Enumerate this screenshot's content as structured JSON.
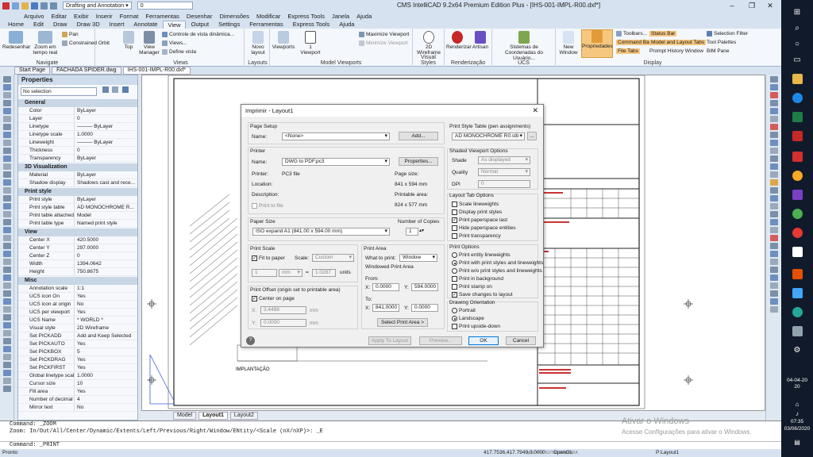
{
  "titlebar": {
    "title": "CMS IntelliCAD 9.2x64 Premium Edition Plus - [IHS-001-IMPL-R00.dxf*]",
    "workspace": "Drafting and Annotation",
    "layer_value": "0",
    "minimize": "–",
    "maximize": "❐",
    "close": "✕"
  },
  "menu": [
    "Arquivo",
    "Editar",
    "Exibir",
    "Inserir",
    "Format",
    "Ferramentas",
    "Desenhar",
    "Dimensões",
    "Modificar",
    "Express Tools",
    "Janela",
    "Ajuda"
  ],
  "ribbon_tabs": [
    "Home",
    "Edit",
    "Draw",
    "Draw 3D",
    "Insert",
    "Annotate",
    "View",
    "Output",
    "Settings",
    "Ferramentas",
    "Express Tools",
    "Ajuda"
  ],
  "ribbon": {
    "navigate": {
      "label": "Navigate",
      "redesenhar": "Redesenhar",
      "zoom": "Zoom em tempo real",
      "pan": "Pan",
      "orbit": "Constrained Orbit"
    },
    "views": {
      "label": "Views",
      "top": "Top",
      "view_manager": "View Manager",
      "controle": "Controle de vista dinâmica...",
      "views": "Views...",
      "define": "Define vista"
    },
    "layouts": {
      "label": "Layouts",
      "novo": "Novo layout"
    },
    "model_viewports": {
      "label": "Model Viewports",
      "viewports": "Viewports",
      "one": "1 Viewport",
      "max": "Maximize Viewport",
      "min": "Minimize Viewport"
    },
    "visual_styles": {
      "label": "Visual Styles",
      "wire": "2D Wireframe"
    },
    "render": {
      "label": "Renderização",
      "renderizar": "Renderizar",
      "artisan": "Artisan"
    },
    "ucs": {
      "label": "UCS",
      "sistemas": "Sistemas de Coordenadas do Usuário..."
    },
    "display": {
      "label": "Display",
      "new_window": "New Window",
      "propriedades": "Propriedades",
      "toolbars": "Toolbars...",
      "command_bar": "Command Bar",
      "file_tabs": "File Tabs",
      "status_bar": "Status Bar",
      "model_layout": "Model and Layout Tabs",
      "prompt_history": "Prompt History Window",
      "selection_filter": "Selection Filter",
      "tool_palettes": "Tool Palettes",
      "bim_pane": "BIM Pane"
    }
  },
  "doc_tabs": [
    "Start Page",
    "FACHADA SPIDER.dwg",
    "IHS-001-IMPL-R00.dxf*"
  ],
  "properties": {
    "title": "Properties",
    "selection": "No selection",
    "sections": [
      {
        "name": "General",
        "rows": [
          [
            "Color",
            "ByLayer"
          ],
          [
            "Layer",
            "0"
          ],
          [
            "Linetype",
            "——— ByLayer"
          ],
          [
            "Linetype scale",
            "1.0000"
          ],
          [
            "Lineweight",
            "——— ByLayer"
          ],
          [
            "Thickness",
            "0"
          ],
          [
            "Transparency",
            "ByLayer"
          ]
        ]
      },
      {
        "name": "3D Visualization",
        "rows": [
          [
            "Material",
            "ByLayer"
          ],
          [
            "Shadow display",
            "Shadows cast and rece..."
          ]
        ]
      },
      {
        "name": "Print style",
        "rows": [
          [
            "Print style",
            "ByLayer"
          ],
          [
            "Print style table",
            "AD MONOCHROME R..."
          ],
          [
            "Print table attached to",
            "Model"
          ],
          [
            "Print table type",
            "Named print style"
          ]
        ]
      },
      {
        "name": "View",
        "rows": [
          [
            "Center X",
            "420.5000"
          ],
          [
            "Center Y",
            "297.0000"
          ],
          [
            "Center Z",
            "0"
          ],
          [
            "Width",
            "1394.0642"
          ],
          [
            "Height",
            "750.8675"
          ]
        ]
      },
      {
        "name": "Misc",
        "rows": [
          [
            "Annotation scale",
            "1:1"
          ],
          [
            "UCS icon On",
            "Yes"
          ],
          [
            "UCS icon at origin",
            "No"
          ],
          [
            "UCS per viewport",
            "Yes"
          ],
          [
            "UCS Name",
            "* WORLD *"
          ],
          [
            "Visual style",
            "2D Wireframe"
          ],
          [
            "Set PICKADD",
            "Add and Keep Selected"
          ],
          [
            "Set PICKAUTO",
            "Yes"
          ],
          [
            "Set PICKBOX",
            "5"
          ],
          [
            "Set PICKDRAG",
            "Yes"
          ],
          [
            "Set PICKFIRST",
            "Yes"
          ],
          [
            "Global linetype scale",
            "1.0000"
          ],
          [
            "Cursor size",
            "10"
          ],
          [
            "Fill area",
            "Yes"
          ],
          [
            "Number of decimal plac...",
            "4"
          ],
          [
            "Mirror text",
            "No"
          ]
        ]
      }
    ]
  },
  "dialog": {
    "title": "Imprimir - Layout1",
    "page_setup": {
      "label": "Page Setup",
      "name_label": "Name:",
      "name_value": "<None>",
      "add": "Add..."
    },
    "printer": {
      "label": "Printer",
      "name_label": "Name:",
      "name_value": "DWG to PDF.pc3",
      "properties": "Properties...",
      "printer_label": "Printer:",
      "printer_value": "PC3 file",
      "location_label": "Location:",
      "description_label": "Description:",
      "page_size_label": "Page size:",
      "page_size_value": "841 x 594 mm",
      "printable_label": "Printable area:",
      "printable_value": "824 x 577 mm",
      "print_to_file": "Print to file"
    },
    "paper_size": {
      "label": "Paper Size",
      "value": "ISO expand A1 (841.00 x 594.00 mm)",
      "copies_label": "Number of Copies",
      "copies": "1"
    },
    "print_scale": {
      "label": "Print Scale",
      "fit": "Fit to paper",
      "scale_label": "Scale:",
      "scale_value": "Custom",
      "left": "1",
      "unit": "mm",
      "eq": "=",
      "right": "1.0287",
      "units": "units"
    },
    "print_area": {
      "label": "Print Area",
      "what_label": "What to print:",
      "what_value": "Window",
      "window_area": "Windowed Print Area",
      "from": "From:",
      "to": "To:",
      "from_x": "0.0000",
      "from_y": "594.0000",
      "to_x": "841.0000",
      "to_y": "0.0000",
      "x": "X:",
      "y": "Y:",
      "select": "Select Print Area >"
    },
    "offset": {
      "label": "Print Offset (origin set to printable area)",
      "center": "Center on page",
      "x": "X:",
      "y": "Y:",
      "x_value": "3.4488",
      "y_value": "0.0000",
      "mm": "mm"
    },
    "style_table": {
      "label": "Print Style Table (pen assignments)",
      "value": "AD MONOCHROME R0.stb",
      "more": "..."
    },
    "shaded": {
      "label": "Shaded Viewport Options",
      "shade_label": "Shade",
      "shade_value": "As displayed",
      "quality_label": "Quality",
      "quality_value": "Normal",
      "dpi_label": "DPI",
      "dpi_value": "0"
    },
    "layout_tab": {
      "label": "Layout Tab Options",
      "items": [
        {
          "text": "Scale lineweights",
          "checked": false
        },
        {
          "text": "Display print styles",
          "checked": false
        },
        {
          "text": "Print paperspace last",
          "checked": true
        },
        {
          "text": "Hide paperspace entities",
          "checked": false
        },
        {
          "text": "Print transparency",
          "checked": false
        }
      ]
    },
    "print_options": {
      "label": "Print Options",
      "radios": [
        {
          "text": "Print entity lineweights",
          "checked": false
        },
        {
          "text": "Print with print styles and lineweights",
          "checked": true
        },
        {
          "text": "Print w/o print styles and lineweights",
          "checked": false
        }
      ],
      "checks": [
        {
          "text": "Print in background",
          "checked": false
        },
        {
          "text": "Print stamp on",
          "checked": false
        },
        {
          "text": "Save changes to layout",
          "checked": true
        }
      ]
    },
    "orientation": {
      "label": "Drawing Orientation",
      "portrait": "Portrait",
      "landscape": "Landscape",
      "upside": "Print upside-down"
    },
    "buttons": {
      "apply": "Apply To Layout",
      "preview": "Preview...",
      "ok": "OK",
      "cancel": "Cancel",
      "help": "?"
    }
  },
  "layout_tabs": [
    "Model",
    "Layout1",
    "Layout2"
  ],
  "command": {
    "line1": "Command: _ZOOM",
    "line2": "Zoom:  In/Out/All/Center/Dynamic/Extents/Left/Previous/Right/Window/ENtity/<Scale (nX/nXP)>: _E",
    "input": "Command: _PRINT"
  },
  "status": {
    "left": "Pronto",
    "coords": "417.7536,417.7949,0.0000",
    "mode": "MEDIA DIGITALIZADORA",
    "opengl": "OpenGL",
    "layout": "P:Layout1"
  },
  "watermark": {
    "title": "Ativar o Windows",
    "sub": "Acesse Configurações para ativar o Windows."
  },
  "drawing_label": "IMPLANTAÇÃO",
  "taskbar": {
    "clock_time": "07:35",
    "clock_date": "03/06/2020",
    "tray_date": "04-04-20",
    "tray_date2": "20"
  },
  "colors": {
    "accent": "#0078d7",
    "ribbon_bg": "#f4f7fb",
    "taskbar": "#111a2a"
  }
}
